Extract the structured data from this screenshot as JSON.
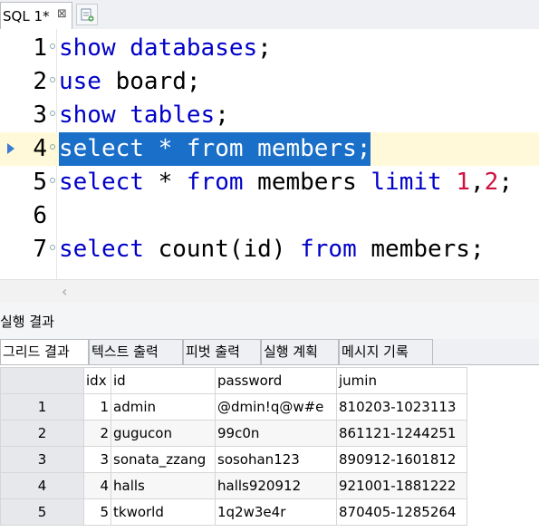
{
  "tab": {
    "title": "SQL 1*",
    "close_glyph": "⊠"
  },
  "editor": {
    "lines": [
      {
        "n": "1",
        "tokens": [
          [
            "kw",
            "show"
          ],
          [
            "pl",
            " "
          ],
          [
            "kw",
            "databases"
          ],
          [
            "pl",
            ";"
          ]
        ]
      },
      {
        "n": "2",
        "tokens": [
          [
            "kw",
            "use"
          ],
          [
            "pl",
            " board;"
          ]
        ]
      },
      {
        "n": "3",
        "tokens": [
          [
            "kw",
            "show"
          ],
          [
            "pl",
            " "
          ],
          [
            "kw",
            "tables"
          ],
          [
            "pl",
            ";"
          ]
        ]
      },
      {
        "n": "4",
        "selected": true,
        "tokens": [
          [
            "kw",
            "select"
          ],
          [
            "pl",
            " * "
          ],
          [
            "kw",
            "from"
          ],
          [
            "pl",
            " members;"
          ]
        ]
      },
      {
        "n": "5",
        "tokens": [
          [
            "kw",
            "select"
          ],
          [
            "pl",
            " * "
          ],
          [
            "kw",
            "from"
          ],
          [
            "pl",
            " members "
          ],
          [
            "kw",
            "limit"
          ],
          [
            "pl",
            " "
          ],
          [
            "num",
            "1"
          ],
          [
            "pl",
            ","
          ],
          [
            "num",
            "2"
          ],
          [
            "pl",
            ";"
          ]
        ]
      },
      {
        "n": "6",
        "tokens": []
      },
      {
        "n": "7",
        "tokens": [
          [
            "kw",
            "select"
          ],
          [
            "pl",
            " count(id) "
          ],
          [
            "kw",
            "from"
          ],
          [
            "pl",
            " members;"
          ]
        ]
      }
    ],
    "colors": {
      "keyword": "#0000c8",
      "number": "#d01040",
      "selection": "#1a6fc9"
    }
  },
  "scroll": {
    "left_glyph": "‹"
  },
  "results": {
    "title": "실행 결과",
    "tabs": [
      "그리드 결과",
      "텍스트 출력",
      "피벗 출력",
      "실행 계획",
      "메시지 기록"
    ],
    "columns": [
      "idx",
      "id",
      "password",
      "jumin"
    ],
    "rows": [
      {
        "row": "1",
        "idx": "1",
        "id": "admin",
        "password": "@dmin!q@w#e",
        "jumin": "810203-1023113"
      },
      {
        "row": "2",
        "idx": "2",
        "id": "gugucon",
        "password": "99c0n",
        "jumin": "861121-1244251"
      },
      {
        "row": "3",
        "idx": "3",
        "id": "sonata_zzang",
        "password": "sosohan123",
        "jumin": "890912-1601812"
      },
      {
        "row": "4",
        "idx": "4",
        "id": "halls",
        "password": "halls920912",
        "jumin": "921001-1881222"
      },
      {
        "row": "5",
        "idx": "5",
        "id": "tkworld",
        "password": "1q2w3e4r",
        "jumin": "870405-1285264"
      }
    ]
  }
}
